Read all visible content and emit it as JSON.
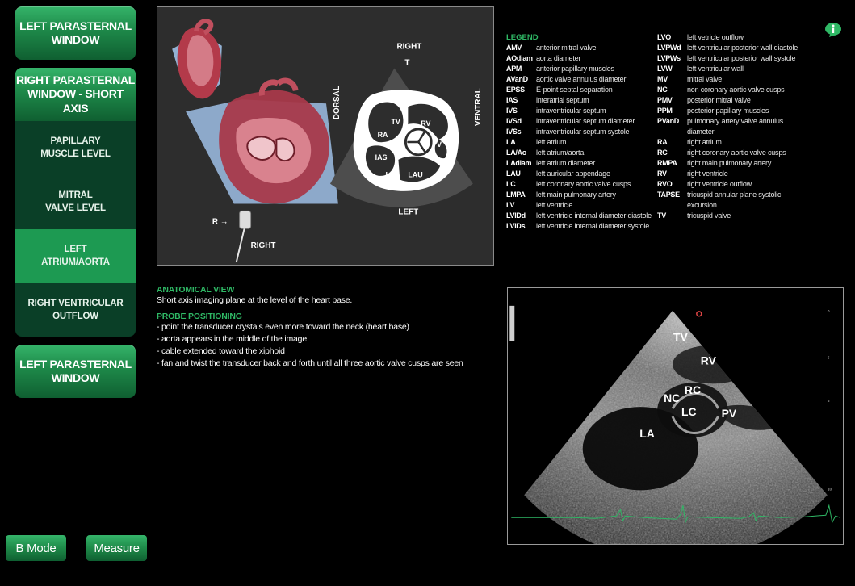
{
  "sidebar": {
    "top_button": "LEFT PARASTERNAL\nWINDOW",
    "section": {
      "title": "RIGHT PARASTERNAL\nWINDOW - SHORT AXIS",
      "items": [
        {
          "label": "PAPILLARY\nMUSCLE LEVEL",
          "active": false
        },
        {
          "label": "MITRAL\nVALVE LEVEL",
          "active": false
        },
        {
          "label": "LEFT\nATRIUM/AORTA",
          "active": true
        },
        {
          "label": "RIGHT VENTRICULAR\nOUTFLOW",
          "active": false
        }
      ]
    },
    "bottom_button": "LEFT PARASTERNAL\nWINDOW"
  },
  "toolbar": {
    "bmode_label": "B Mode",
    "measure_label": "Measure"
  },
  "diagram": {
    "labels": {
      "right_top": "RIGHT",
      "t": "T",
      "dorsal": "DORSAL",
      "ventral": "VENTRAL",
      "left": "LEFT",
      "r_arrow": "R →",
      "right_bottom": "RIGHT",
      "tv": "TV",
      "rv": "RV",
      "ra": "RA",
      "pv": "PV",
      "ias": "IAS",
      "la": "LA",
      "lau": "LAU"
    }
  },
  "description": {
    "anatomical_title": "ANATOMICAL VIEW",
    "anatomical_text": "Short axis imaging plane at the level of the heart base.",
    "probe_title": "PROBE POSITIONING",
    "probe_items": [
      "point the transducer crystals even more toward the neck (heart base)",
      "aorta appears in the middle of the image",
      "cable extended toward the xiphoid",
      "fan and twist the transducer back and forth until all three aortic valve cusps are seen"
    ]
  },
  "legend": {
    "title": "LEGEND",
    "col1": [
      {
        "abbr": "AMV",
        "meaning": "anterior mitral valve"
      },
      {
        "abbr": "AOdiam",
        "meaning": "aorta diameter"
      },
      {
        "abbr": "APM",
        "meaning": "anterior papillary muscles"
      },
      {
        "abbr": "AVanD",
        "meaning": "aortic valve annulus diameter"
      },
      {
        "abbr": "EPSS",
        "meaning": "E-point septal separation"
      },
      {
        "abbr": "IAS",
        "meaning": "interatrial septum"
      },
      {
        "abbr": "IVS",
        "meaning": "intraventricular septum"
      },
      {
        "abbr": "IVSd",
        "meaning": "intraventricular septum diameter"
      },
      {
        "abbr": "IVSs",
        "meaning": "intraventricular septum systole"
      },
      {
        "abbr": "LA",
        "meaning": "left atrium"
      },
      {
        "abbr": "LA/Ao",
        "meaning": "left atrium/aorta"
      },
      {
        "abbr": "LAdiam",
        "meaning": "left atrium diameter"
      },
      {
        "abbr": "LAU",
        "meaning": "left auricular appendage"
      },
      {
        "abbr": "LC",
        "meaning": "left coronary aortic valve cusps"
      },
      {
        "abbr": "LMPA",
        "meaning": "left main pulmonary artery"
      },
      {
        "abbr": "LV",
        "meaning": "left ventricle"
      },
      {
        "abbr": "LVIDd",
        "meaning": "left ventricle internal diameter diastole"
      },
      {
        "abbr": "LVIDs",
        "meaning": "left ventricle internal diameter systole"
      }
    ],
    "col2": [
      {
        "abbr": "LVO",
        "meaning": "left vetricle outflow"
      },
      {
        "abbr": "LVPWd",
        "meaning": "left ventricular posterior wall diastole"
      },
      {
        "abbr": "LVPWs",
        "meaning": "left ventricular posterior wall systole"
      },
      {
        "abbr": "LVW",
        "meaning": "left ventricular wall"
      },
      {
        "abbr": "MV",
        "meaning": "mitral valve"
      },
      {
        "abbr": "NC",
        "meaning": "non coronary aortic valve cusps"
      },
      {
        "abbr": "PMV",
        "meaning": "posterior mitral valve"
      },
      {
        "abbr": "PPM",
        "meaning": "posterior papillary muscles"
      },
      {
        "abbr": "PVanD",
        "meaning": "pulmonary artery valve annulus diameter"
      },
      {
        "abbr": "RA",
        "meaning": "right atrium"
      },
      {
        "abbr": "RC",
        "meaning": "right coronary aortic valve cusps"
      },
      {
        "abbr": "RMPA",
        "meaning": "right main pulmonary artery"
      },
      {
        "abbr": "RV",
        "meaning": "right ventricle"
      },
      {
        "abbr": "RVO",
        "meaning": "right ventricle outflow"
      },
      {
        "abbr": "TAPSE",
        "meaning": "tricuspid annular plane systolic excursion"
      },
      {
        "abbr": "TV",
        "meaning": "tricuspid valve"
      }
    ]
  },
  "ultrasound": {
    "labels": {
      "tv": "TV",
      "rv": "RV",
      "rc": "RC",
      "nc": "NC",
      "lc": "LC",
      "pv": "PV",
      "la": "LA"
    }
  },
  "colors": {
    "accent": "#2fb865",
    "button_green": "#1f8c4b",
    "panel_bg": "#2d2d2d"
  },
  "icons": {
    "info": "info-icon"
  }
}
